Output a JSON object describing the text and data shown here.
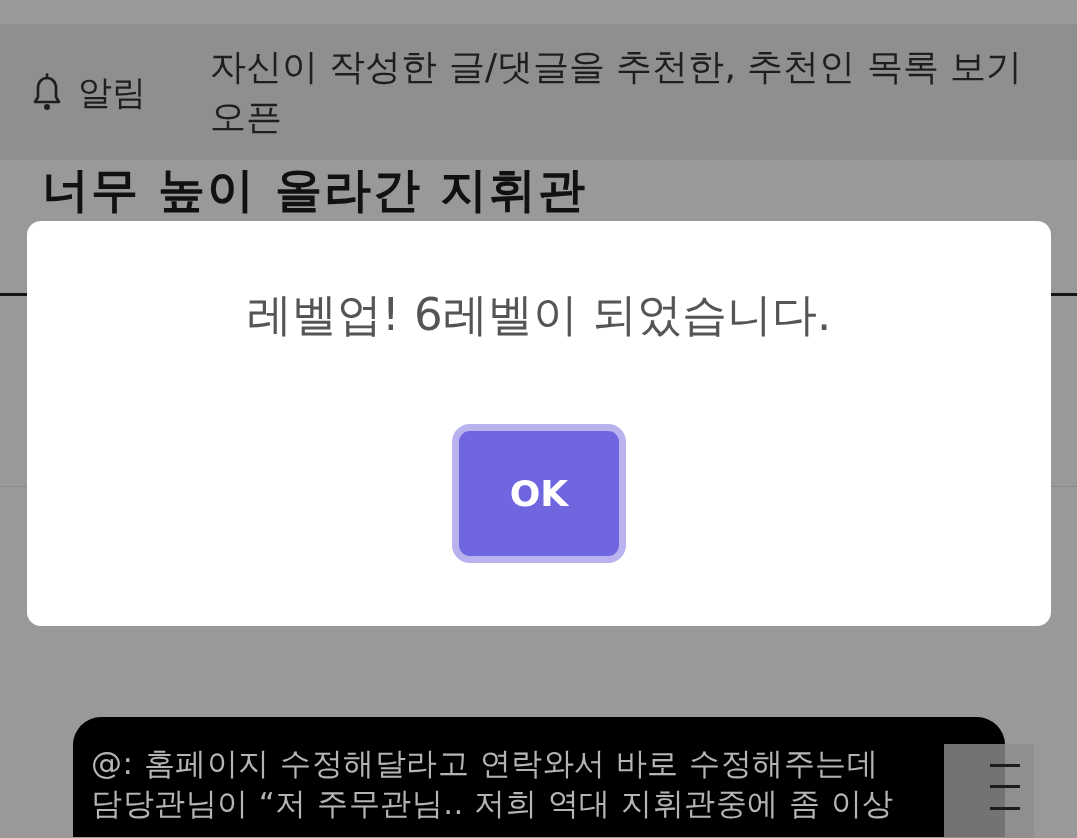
{
  "notice_bar": {
    "label": "알림",
    "message": "자신이 작성한 글/댓글을 추천한, 추천인 목록 보기 오픈"
  },
  "post": {
    "title": "너무 높이 올라간 지휘관",
    "quote_lines": [
      "@: 홈페이지 수정해달라고 연락와서 바로 수정해주는데",
      "담당관님이 “저 주무관님.. 저희 역대 지휘관중에 좀 이상"
    ]
  },
  "dialog": {
    "message": "레벨업! 6레벨이 되었습니다.",
    "button": {
      "label": "OK",
      "focused": true
    }
  }
}
